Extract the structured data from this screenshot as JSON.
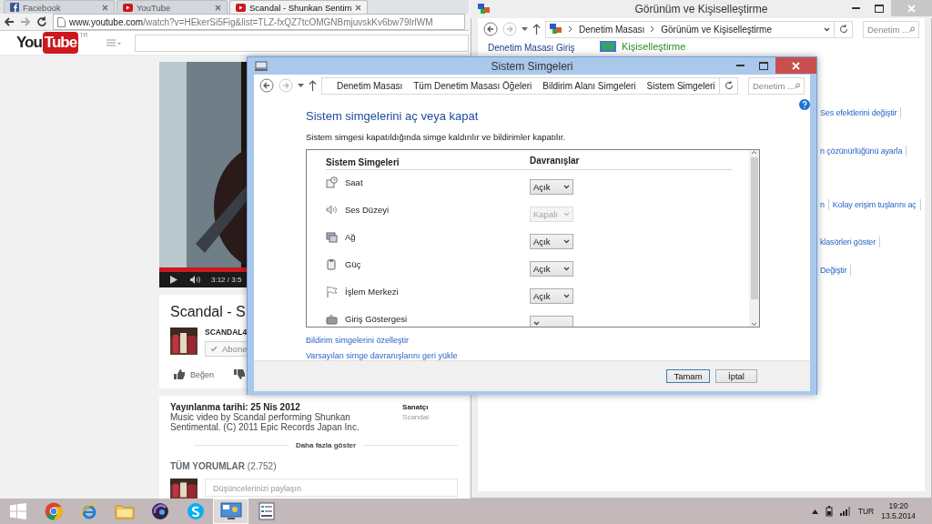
{
  "browser": {
    "tabs": [
      {
        "label": "Facebook",
        "kind": "facebook",
        "selected": false
      },
      {
        "label": "YouTube",
        "kind": "youtube",
        "selected": false
      },
      {
        "label": "Scandal - Shunkan Sentim",
        "kind": "youtube",
        "selected": true
      }
    ],
    "url_host": "www.youtube.com",
    "url_path": "/watch?v=HEkerSi5Fig&list=TLZ-fxQZ7tcOMGNBmjuvskKv6bw79IrlWM",
    "youtube": {
      "logo_you": "You",
      "logo_tube": "Tube",
      "region": "TR",
      "progress": {
        "level": 0.83
      },
      "time": "3:12 / 3:5",
      "video_title": "Scandal - S",
      "channel": "SCANDAL4",
      "subscribe": "Abone",
      "like": "Beğen",
      "published": "Yayınlanma tarihi: 25 Nis 2012",
      "description": "Music video by Scandal performing Shunkan Sentimental. (C) 2011 Epic Records Japan Inc.",
      "artist_label": "Sanatçı",
      "artist": "Scandal",
      "show_more": "Daha fazla göster",
      "comments_heading": "TÜM YORUMLAR",
      "comments_count": "(2.752)",
      "comment_placeholder": "Düşüncelerinizi paylaşın"
    }
  },
  "back_window": {
    "title": "Görünüm ve Kişiselleştirme",
    "breadcrumb": [
      "Denetim Masası",
      "Görünüm ve Kişiselleştirme"
    ],
    "search_placeholder": "Denetim ...",
    "sidebar": [
      "Denetim Masası Giriş"
    ],
    "heading": "Kişiselleştirme",
    "link_rows": [
      [
        "Ses efektlerini değiştir"
      ],
      [
        "n çözünürlüğünü ayarla"
      ],
      [
        "n",
        "Kolay erişim tuşlarını aç"
      ],
      [
        "klasörleri göster"
      ],
      [
        "Değiştir"
      ]
    ]
  },
  "dialog": {
    "title": "Sistem Simgeleri",
    "breadcrumb": [
      "Denetim Masası",
      "Tüm Denetim Masası Öğeleri",
      "Bildirim Alanı Simgeleri",
      "Sistem Simgeleri"
    ],
    "search_placeholder": "Denetim ...",
    "heading": "Sistem simgelerini aç veya kapat",
    "description": "Sistem simgesi kapatıldığında simge kaldırılır ve bildirimler kapatılır.",
    "columns": [
      "Sistem Simgeleri",
      "Davranışlar"
    ],
    "rows": [
      {
        "name": "Saat",
        "kind": "clock",
        "value": "Açık",
        "disabled": false
      },
      {
        "name": "Ses Düzeyi",
        "kind": "speaker",
        "value": "Kapalı",
        "disabled": true
      },
      {
        "name": "Ağ",
        "kind": "network",
        "value": "Açık",
        "disabled": false
      },
      {
        "name": "Güç",
        "kind": "power",
        "value": "Açık",
        "disabled": false
      },
      {
        "name": "İşlem Merkezi",
        "kind": "flag",
        "value": "Açık",
        "disabled": false
      },
      {
        "name": "Giriş Göstergesi",
        "kind": "keyboard",
        "disabled": false
      }
    ],
    "links": [
      "Bildirim simgelerini özelleştir",
      "Varsayılan simge davranışlarını geri yükle"
    ],
    "buttons": [
      {
        "label": "Tamam",
        "default": true
      },
      {
        "label": "İptal",
        "default": false
      }
    ]
  },
  "taskbar": {
    "apps": [
      {
        "kind": "start",
        "selected": false
      },
      {
        "kind": "chrome",
        "selected": false
      },
      {
        "kind": "ie",
        "selected": false
      },
      {
        "kind": "folder",
        "selected": false
      },
      {
        "kind": "orb",
        "selected": false
      },
      {
        "kind": "skype",
        "selected": false
      },
      {
        "kind": "control-panel",
        "selected": true
      },
      {
        "kind": "settings-window",
        "selected": false
      }
    ],
    "language": "TUR",
    "time": "19:20",
    "date": "13.5.2014"
  }
}
